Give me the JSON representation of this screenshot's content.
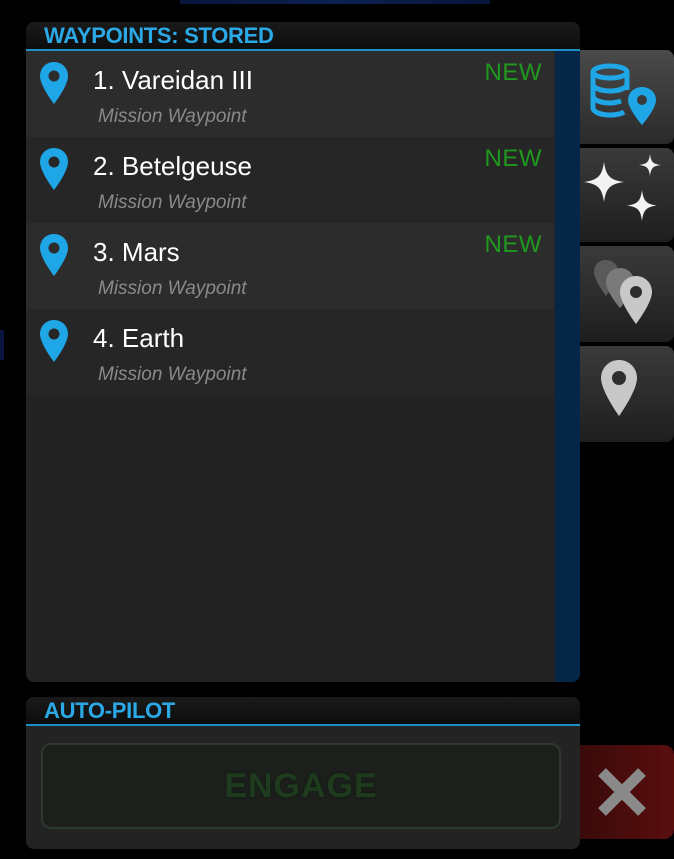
{
  "waypoints_panel": {
    "title": "WAYPOINTS: STORED",
    "items": [
      {
        "name": "1. Vareidan III",
        "type": "Mission Waypoint",
        "badge": "NEW"
      },
      {
        "name": "2. Betelgeuse",
        "type": "Mission Waypoint",
        "badge": "NEW"
      },
      {
        "name": "3. Mars",
        "type": "Mission Waypoint",
        "badge": "NEW"
      },
      {
        "name": "4. Earth",
        "type": "Mission Waypoint",
        "badge": ""
      }
    ]
  },
  "side_tabs": [
    {
      "icon": "database-waypoint-icon",
      "active": true
    },
    {
      "icon": "stars-icon",
      "active": false
    },
    {
      "icon": "multiple-waypoints-icon",
      "active": false
    },
    {
      "icon": "waypoint-icon",
      "active": false
    }
  ],
  "autopilot_panel": {
    "title": "AUTO-PILOT",
    "engage_label": "ENGAGE"
  },
  "close_button": {
    "icon": "close-icon"
  },
  "colors": {
    "accent": "#2ba9e6",
    "new_badge": "#1f9a1f",
    "engage_text": "#1e3b1e",
    "close_bg": "#5a0e0e"
  }
}
